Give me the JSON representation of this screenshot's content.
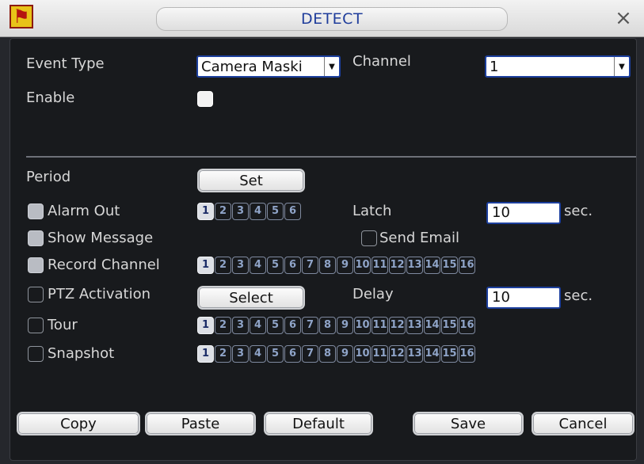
{
  "window": {
    "title": "DETECT",
    "logo_icon": "running-man-icon",
    "close_icon": "close-icon"
  },
  "colors": {
    "title_text": "#1f3d9b",
    "field_border": "#1c3f9d",
    "background": "#181a1d"
  },
  "event_type": {
    "label": "Event Type",
    "value": "Camera Maski"
  },
  "channel": {
    "label": "Channel",
    "value": "1"
  },
  "enable": {
    "label": "Enable",
    "checked": true
  },
  "period": {
    "label": "Period",
    "button": "Set"
  },
  "alarm_out": {
    "label": "Alarm Out",
    "checked": true,
    "channels": [
      "1",
      "2",
      "3",
      "4",
      "5",
      "6"
    ],
    "selected": [
      "1"
    ]
  },
  "latch": {
    "label": "Latch",
    "value": "10",
    "unit": "sec."
  },
  "show_message": {
    "label": "Show Message",
    "checked": true
  },
  "send_email": {
    "label": "Send Email",
    "checked": false
  },
  "record_channel": {
    "label": "Record Channel",
    "checked": true,
    "channels": [
      "1",
      "2",
      "3",
      "4",
      "5",
      "6",
      "7",
      "8",
      "9",
      "10",
      "11",
      "12",
      "13",
      "14",
      "15",
      "16"
    ],
    "selected": [
      "1"
    ]
  },
  "ptz_activation": {
    "label": "PTZ Activation",
    "checked": false,
    "button": "Select"
  },
  "delay": {
    "label": "Delay",
    "value": "10",
    "unit": "sec."
  },
  "tour": {
    "label": "Tour",
    "checked": false,
    "channels": [
      "1",
      "2",
      "3",
      "4",
      "5",
      "6",
      "7",
      "8",
      "9",
      "10",
      "11",
      "12",
      "13",
      "14",
      "15",
      "16"
    ],
    "selected": [
      "1"
    ]
  },
  "snapshot": {
    "label": "Snapshot",
    "checked": false,
    "channels": [
      "1",
      "2",
      "3",
      "4",
      "5",
      "6",
      "7",
      "8",
      "9",
      "10",
      "11",
      "12",
      "13",
      "14",
      "15",
      "16"
    ],
    "selected": [
      "1"
    ]
  },
  "buttons": {
    "copy": "Copy",
    "paste": "Paste",
    "default": "Default",
    "save": "Save",
    "cancel": "Cancel"
  }
}
